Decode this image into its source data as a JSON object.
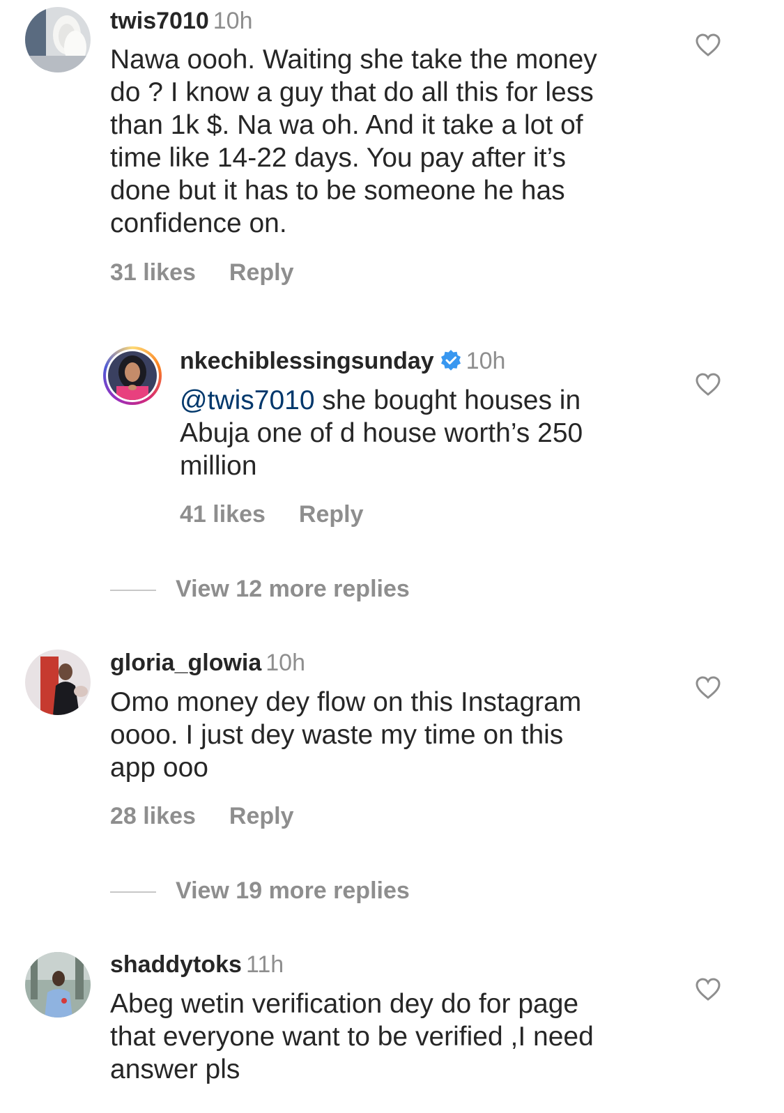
{
  "comments": [
    {
      "username": "twis7010",
      "time": "10h",
      "lines": [
        "Nawa oooh. Waiting she take the money",
        "do ? I know a guy that do all this for less",
        "than 1k $. Na wa oh. And it take a lot of",
        "time like 14-22 days. You pay after it’s",
        "done but it has to be someone he has",
        "confidence on."
      ],
      "likes": "31 likes",
      "reply_label": "Reply"
    },
    {
      "username": "nkechiblessingsunday",
      "time": "10h",
      "mention": "@twis7010",
      "lines": [
        " she bought houses in",
        "Abuja one of d house worth’s 250",
        "million"
      ],
      "likes": "41 likes",
      "reply_label": "Reply",
      "verified_icon": "verified-badge-icon"
    },
    {
      "username": "gloria_glowia",
      "time": "10h",
      "lines": [
        "Omo money dey flow on this Instagram",
        "oooo. I just dey waste my time on this",
        "app ooo"
      ],
      "likes": "28 likes",
      "reply_label": "Reply"
    },
    {
      "username": "shaddytoks",
      "time": "11h",
      "lines": [
        "Abeg wetin verification dey do for page",
        "that everyone want to be verified ,I need",
        "answer pls"
      ]
    }
  ],
  "view_replies": [
    {
      "label": "View 12 more replies"
    },
    {
      "label": "View 19 more replies"
    }
  ],
  "colors": {
    "text": "#262626",
    "muted": "#8e8e8e",
    "mention": "#00376b",
    "verified": "#3897f0"
  },
  "icons": [
    "heart-icon",
    "verified-badge-icon"
  ]
}
